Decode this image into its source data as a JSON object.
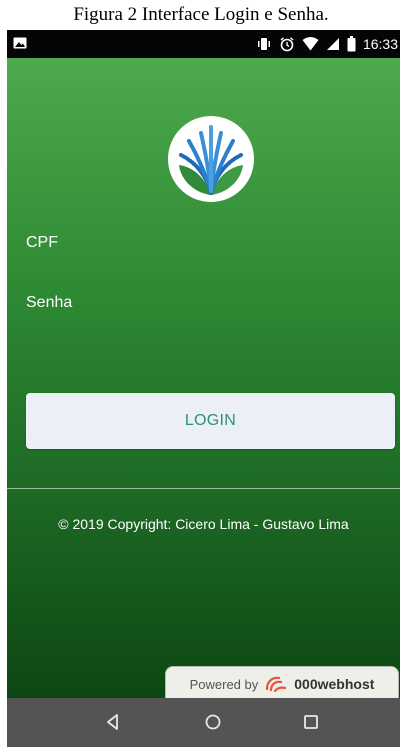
{
  "caption": "Figura 2 Interface Login e Senha.",
  "status_bar": {
    "time": "16:33",
    "icons": [
      "gallery-icon",
      "vibrate-icon",
      "alarm-icon",
      "wifi-icon",
      "signal-icon",
      "battery-icon"
    ]
  },
  "login": {
    "cpf_label": "CPF",
    "senha_label": "Senha",
    "button_label": "LOGIN"
  },
  "footer": {
    "copyright": "© 2019 Copyright: Cicero Lima - Gustavo Lima"
  },
  "powered_by": {
    "prefix": "Powered by",
    "brand": "000webhost"
  },
  "nav": {
    "icons": [
      "back-icon",
      "home-icon",
      "recents-icon"
    ]
  },
  "colors": {
    "app_gradient_top": "#4ea94e",
    "app_gradient_bottom": "#0d4713",
    "button_bg": "#eceff6",
    "button_text": "#2b9182",
    "status_bar": "#050505",
    "nav_bar": "#545454"
  }
}
